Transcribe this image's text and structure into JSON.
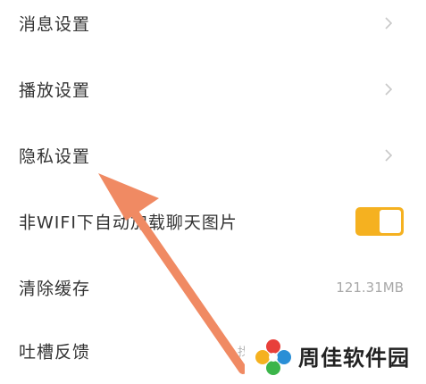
{
  "settings": {
    "items": [
      {
        "label": "消息设置",
        "type": "link"
      },
      {
        "label": "播放设置",
        "type": "link"
      },
      {
        "label": "隐私设置",
        "type": "link"
      },
      {
        "label": "非WIFI下自动加载聊天图片",
        "type": "toggle",
        "enabled": true
      },
      {
        "label": "清除缓存",
        "type": "value",
        "value": "121.31MB"
      },
      {
        "label": "吐槽反馈",
        "type": "link",
        "trailing_fragment": "找"
      }
    ]
  },
  "colors": {
    "toggle_on": "#f5b120",
    "annotation_arrow": "#f08a63",
    "chevron": "#c8c8c8"
  },
  "watermark": {
    "text": "周佳软件园",
    "icon": "colorful-pinwheel-logo"
  }
}
